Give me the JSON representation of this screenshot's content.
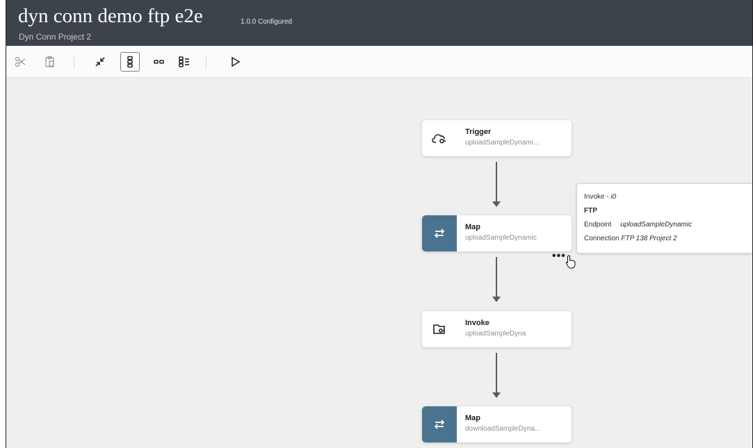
{
  "header": {
    "title": "dyn conn demo ftp e2e",
    "project": "Dyn Conn Project 2",
    "version": "1.0.0 Configured"
  },
  "toolbar": {
    "buttons": [
      {
        "icon": "scissors-icon",
        "state": "disabled"
      },
      {
        "icon": "paste-icon",
        "state": "disabled"
      },
      {
        "icon": "collapse-icon",
        "state": "enabled"
      },
      {
        "icon": "vertical-layout-icon",
        "state": "selected"
      },
      {
        "icon": "horizontal-layout-icon",
        "state": "enabled"
      },
      {
        "icon": "pseudo-view-icon",
        "state": "enabled"
      },
      {
        "icon": "play-icon",
        "state": "enabled"
      }
    ]
  },
  "nodes": [
    {
      "type": "Trigger",
      "name": "Trigger",
      "sub": "uploadSampleDynami...",
      "icon": "cloud-trigger-icon"
    },
    {
      "type": "Map",
      "name": "Map",
      "sub": "uploadSampleDynamic",
      "icon": "map-arrows-icon"
    },
    {
      "type": "Invoke",
      "name": "Invoke",
      "sub": "uploadSampleDyna",
      "icon": "folder-invoke-icon"
    },
    {
      "type": "Map",
      "name": "Map",
      "sub": "downloadSampleDyna...",
      "icon": "map-arrows-icon"
    }
  ],
  "tooltip": {
    "heading_prefix": "Invoke - ",
    "heading_id": "i0",
    "adapter": "FTP",
    "endpoint_label": "Endpoint",
    "endpoint_value": "uploadSampleDynamic",
    "connection_label": "Connection",
    "connection_value": "FTP 138 Project 2"
  },
  "colors": {
    "header_bg": "#3d434b",
    "canvas_bg": "#efefed",
    "map_icon_bg": "#4a7390"
  }
}
